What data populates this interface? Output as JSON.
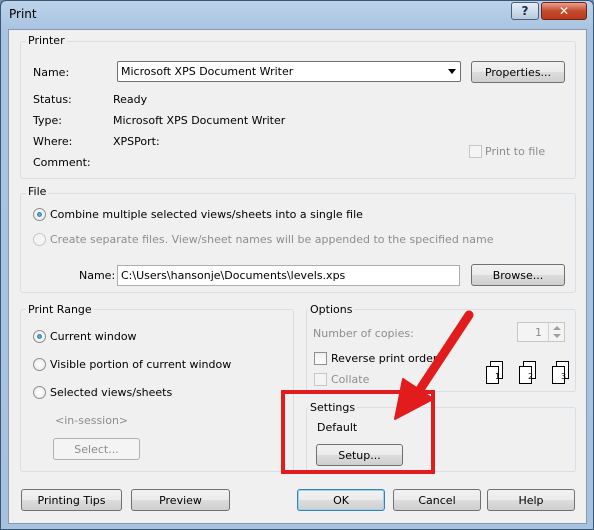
{
  "window": {
    "title": "Print"
  },
  "titlebar": {
    "help_glyph": "?",
    "close_glyph": "✕"
  },
  "printer": {
    "group_label": "Printer",
    "name_label": "Name:",
    "name_value": "Microsoft XPS Document Writer",
    "properties_button": "Properties...",
    "status_label": "Status:",
    "status_value": "Ready",
    "type_label": "Type:",
    "type_value": "Microsoft XPS Document Writer",
    "where_label": "Where:",
    "where_value": "XPSPort:",
    "comment_label": "Comment:",
    "print_to_file": "Print to file"
  },
  "file": {
    "group_label": "File",
    "combine_option": "Combine multiple selected views/sheets into a single file",
    "separate_option": "Create separate files. View/sheet names will be appended to the specified name",
    "name_label": "Name:",
    "name_value": "C:\\Users\\hansonje\\Documents\\levels.xps",
    "browse_button": "Browse..."
  },
  "print_range": {
    "group_label": "Print Range",
    "current_window": "Current window",
    "visible_portion": "Visible portion of current window",
    "selected_views": "Selected views/sheets",
    "in_session": "<in-session>",
    "select_button": "Select..."
  },
  "options": {
    "group_label": "Options",
    "copies_label": "Number of copies:",
    "copies_value": "1",
    "reverse_order": "Reverse print order",
    "collate": "Collate",
    "collate_pages": [
      "1",
      "2",
      "3"
    ]
  },
  "settings": {
    "group_label": "Settings",
    "value": "Default",
    "setup_button": "Setup..."
  },
  "footer": {
    "printing_tips": "Printing Tips",
    "preview": "Preview",
    "ok": "OK",
    "cancel": "Cancel",
    "help": "Help"
  },
  "annotation": {
    "color": "#e21c1c"
  }
}
